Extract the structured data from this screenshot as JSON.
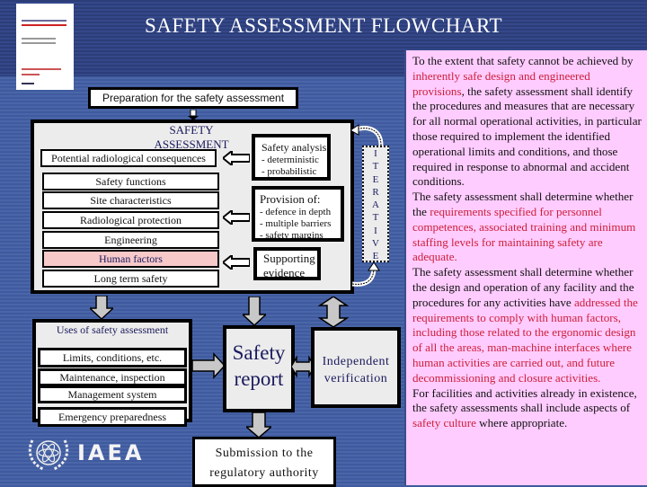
{
  "header": {
    "title": "SAFETY ASSESSMENT FLOWCHART",
    "book_cover_icon": "iaea-safety-standards-book-icon"
  },
  "flowchart": {
    "preparation": "Preparation for the safety assessment",
    "safety_assessment": {
      "title": "SAFETY ASSESSMENT",
      "items": [
        {
          "label": "Potential radiological consequences",
          "highlight": false
        },
        {
          "label": "Safety functions",
          "highlight": false
        },
        {
          "label": "Site characteristics",
          "highlight": false
        },
        {
          "label": "Radiological protection",
          "highlight": false
        },
        {
          "label": "Engineering",
          "highlight": false
        },
        {
          "label": "Human factors",
          "highlight": true
        },
        {
          "label": "Long term safety",
          "highlight": false
        }
      ]
    },
    "safety_analysis": {
      "title": "Safety analysis",
      "lines": [
        "- deterministic",
        "- probabilistic"
      ]
    },
    "provision": {
      "title": "Provision of:",
      "lines": [
        "- defence in depth",
        "- multiple barriers",
        "- safety margins"
      ]
    },
    "supporting_evidence": {
      "lines": [
        "Supporting",
        "evidence"
      ]
    },
    "iterative": [
      "I",
      "T",
      "E",
      "R",
      "A",
      "T",
      "I",
      "V",
      "E"
    ],
    "uses": {
      "title": "Uses of safety assessment",
      "items": [
        "Limits, conditions, etc.",
        "Maintenance, inspection",
        "Management system",
        "Emergency preparedness"
      ]
    },
    "safety_report": [
      "Safety",
      "report"
    ],
    "independent_verification": [
      "Independent",
      "verification"
    ],
    "submission": [
      "Submission to the",
      "regulatory authority"
    ]
  },
  "logo": {
    "text": "IAEA"
  },
  "sidebar": {
    "highlight_color": "#cc1f3a",
    "background_color": "#ffccff",
    "paragraphs": [
      [
        {
          "text": "To the extent that safety cannot be achieved by ",
          "hl": false
        },
        {
          "text": "inherently safe design and engineered provisions",
          "hl": true
        },
        {
          "text": ", the safety assessment shall identify the procedures and measures that are necessary for all normal operational activities, in particular those required to implement the identified operational limits and conditions, and those required in response to abnormal and accident conditions.",
          "hl": false
        }
      ],
      [
        {
          "text": "The safety assessment shall  determine whether the ",
          "hl": false
        },
        {
          "text": "requirements specified for personnel competences, associated training and minimum staffing levels for maintaining safety are adequate.",
          "hl": true
        }
      ],
      [
        {
          "text": "The safety assessment shall  determine whether the design and operation of any facility and the procedures for any activities have ",
          "hl": false
        },
        {
          "text": "addressed the requirements to comply with human factors, including those related to the ergonomic design of all the areas, man-machine interfaces where human activities are carried out, and future decommissioning and closure activities.",
          "hl": true
        }
      ],
      [
        {
          "text": "For facilities and activities already in existence, the safety assessments shall include aspects of ",
          "hl": false
        },
        {
          "text": "safety culture",
          "hl": true
        },
        {
          "text": " where appropriate.",
          "hl": false
        }
      ]
    ]
  }
}
